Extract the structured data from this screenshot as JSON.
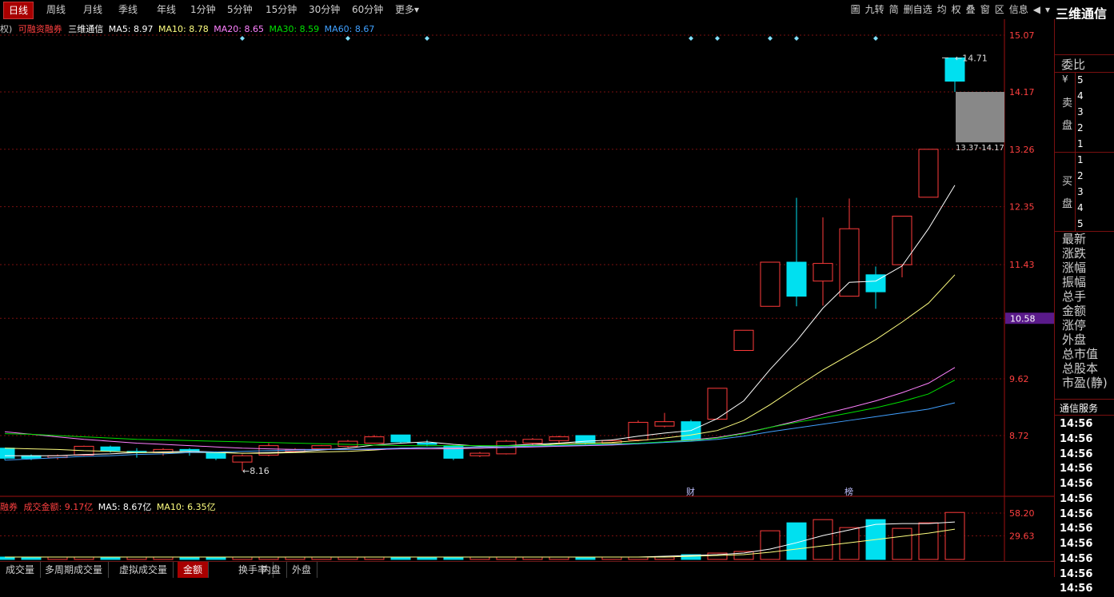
{
  "toolbar": {
    "tabs": [
      "日线",
      "周线",
      "月线",
      "季线",
      "年线",
      "1分钟",
      "5分钟",
      "15分钟",
      "30分钟",
      "60分钟",
      "更多▾"
    ],
    "tools": [
      "圖",
      "九转",
      "简",
      "删自选",
      "均",
      "权",
      "叠",
      "窗",
      "区",
      "信息"
    ],
    "arrow_left": "◀",
    "arrow_down": "▾"
  },
  "stock": {
    "name": "三维通信"
  },
  "main_info": {
    "prefix": "权)",
    "tag": "可融资融券",
    "name": "三维通信",
    "ma5": "MA5: 8.97",
    "ma10": "MA10: 8.78",
    "ma20": "MA20: 8.65",
    "ma30": "MA30: 8.59",
    "ma60": "MA60: 8.67"
  },
  "vol_info": {
    "prefix": "融券",
    "label": "成交金额: 9.17亿",
    "ma5": "MA5: 8.67亿",
    "ma10": "MA10: 6.35亿"
  },
  "colors": {
    "up": "#ff3b3b",
    "down": "#00e0f0",
    "ma5": "#ffffff",
    "ma10": "#ffff80",
    "ma20": "#ff80ff",
    "ma30": "#00e000",
    "ma60": "#40a0ff",
    "grid": "#7a1010",
    "axis_text": "#ff4040"
  },
  "chart_data": [
    {
      "type": "candlestick",
      "y_ticks": [
        15.07,
        14.17,
        13.26,
        12.35,
        11.43,
        10.58,
        9.62,
        8.72
      ],
      "current_price_label": "10.58",
      "annotations": [
        {
          "text": "14.71",
          "candle_index": 36,
          "price": 14.71
        },
        {
          "text": "8.16",
          "candle_index": 9,
          "price": 8.16
        },
        {
          "text": "13.37-14.17",
          "range": [
            13.37,
            14.17
          ]
        }
      ],
      "event_markers": [
        {
          "text": "财",
          "candle_index": 26
        },
        {
          "text": "榜",
          "candle_index": 32
        }
      ],
      "candles": [
        {
          "o": 8.52,
          "h": 8.52,
          "l": 8.33,
          "c": 8.36
        },
        {
          "o": 8.4,
          "h": 8.42,
          "l": 8.33,
          "c": 8.36
        },
        {
          "o": 8.37,
          "h": 8.42,
          "l": 8.34,
          "c": 8.4
        },
        {
          "o": 8.41,
          "h": 8.56,
          "l": 8.4,
          "c": 8.55
        },
        {
          "o": 8.54,
          "h": 8.56,
          "l": 8.45,
          "c": 8.48
        },
        {
          "o": 8.47,
          "h": 8.52,
          "l": 8.37,
          "c": 8.45
        },
        {
          "o": 8.45,
          "h": 8.52,
          "l": 8.4,
          "c": 8.5
        },
        {
          "o": 8.5,
          "h": 8.52,
          "l": 8.4,
          "c": 8.48
        },
        {
          "o": 8.46,
          "h": 8.47,
          "l": 8.33,
          "c": 8.36
        },
        {
          "o": 8.3,
          "h": 8.42,
          "l": 8.16,
          "c": 8.4
        },
        {
          "o": 8.41,
          "h": 8.6,
          "l": 8.39,
          "c": 8.56
        },
        {
          "o": 8.47,
          "h": 8.52,
          "l": 8.45,
          "c": 8.5
        },
        {
          "o": 8.51,
          "h": 8.57,
          "l": 8.49,
          "c": 8.56
        },
        {
          "o": 8.55,
          "h": 8.65,
          "l": 8.53,
          "c": 8.63
        },
        {
          "o": 8.6,
          "h": 8.73,
          "l": 8.59,
          "c": 8.7
        },
        {
          "o": 8.73,
          "h": 8.73,
          "l": 8.6,
          "c": 8.62
        },
        {
          "o": 8.6,
          "h": 8.65,
          "l": 8.55,
          "c": 8.58
        },
        {
          "o": 8.56,
          "h": 8.57,
          "l": 8.33,
          "c": 8.36
        },
        {
          "o": 8.4,
          "h": 8.46,
          "l": 8.38,
          "c": 8.44
        },
        {
          "o": 8.43,
          "h": 8.65,
          "l": 8.42,
          "c": 8.63
        },
        {
          "o": 8.6,
          "h": 8.68,
          "l": 8.55,
          "c": 8.66
        },
        {
          "o": 8.64,
          "h": 8.72,
          "l": 8.6,
          "c": 8.7
        },
        {
          "o": 8.72,
          "h": 8.72,
          "l": 8.58,
          "c": 8.6
        },
        {
          "o": 8.6,
          "h": 8.66,
          "l": 8.58,
          "c": 8.64
        },
        {
          "o": 8.65,
          "h": 8.96,
          "l": 8.63,
          "c": 8.93
        },
        {
          "o": 8.87,
          "h": 9.08,
          "l": 8.85,
          "c": 8.94
        },
        {
          "o": 8.94,
          "h": 8.97,
          "l": 8.63,
          "c": 8.65
        },
        {
          "o": 8.98,
          "h": 9.47,
          "l": 8.98,
          "c": 9.47
        },
        {
          "o": 10.07,
          "h": 10.39,
          "l": 10.07,
          "c": 10.39
        },
        {
          "o": 10.77,
          "h": 11.47,
          "l": 10.77,
          "c": 11.47
        },
        {
          "o": 11.47,
          "h": 12.49,
          "l": 10.77,
          "c": 10.93
        },
        {
          "o": 11.17,
          "h": 12.18,
          "l": 10.78,
          "c": 11.45
        },
        {
          "o": 10.93,
          "h": 12.48,
          "l": 10.93,
          "c": 12.0
        },
        {
          "o": 11.27,
          "h": 11.4,
          "l": 10.73,
          "c": 11.0
        },
        {
          "o": 11.43,
          "h": 11.43,
          "l": 11.23,
          "c": 12.2
        },
        {
          "o": 12.5,
          "h": 13.26,
          "l": 12.5,
          "c": 13.26
        },
        {
          "o": 14.71,
          "h": 14.71,
          "l": 14.17,
          "c": 14.34
        }
      ],
      "ma": {
        "ma5": [
          8.4,
          8.4,
          8.4,
          8.42,
          8.43,
          8.45,
          8.46,
          8.47,
          8.46,
          8.44,
          8.45,
          8.46,
          8.49,
          8.52,
          8.57,
          8.6,
          8.62,
          8.58,
          8.55,
          8.56,
          8.58,
          8.6,
          8.63,
          8.65,
          8.71,
          8.76,
          8.8,
          8.99,
          9.27,
          9.77,
          10.22,
          10.74,
          11.15,
          11.17,
          11.41,
          12.0,
          12.69
        ],
        "ma10": [
          8.52,
          8.51,
          8.5,
          8.48,
          8.47,
          8.45,
          8.45,
          8.45,
          8.45,
          8.44,
          8.44,
          8.45,
          8.46,
          8.47,
          8.49,
          8.52,
          8.53,
          8.52,
          8.52,
          8.54,
          8.56,
          8.59,
          8.6,
          8.61,
          8.64,
          8.68,
          8.73,
          8.8,
          8.96,
          9.21,
          9.49,
          9.76,
          10.0,
          10.24,
          10.52,
          10.82,
          11.27
        ],
        "ma20": [
          8.78,
          8.74,
          8.7,
          8.66,
          8.63,
          8.6,
          8.58,
          8.56,
          8.54,
          8.52,
          8.51,
          8.5,
          8.5,
          8.5,
          8.5,
          8.51,
          8.51,
          8.51,
          8.52,
          8.53,
          8.54,
          8.55,
          8.56,
          8.57,
          8.59,
          8.62,
          8.65,
          8.69,
          8.76,
          8.85,
          8.95,
          9.06,
          9.16,
          9.27,
          9.4,
          9.55,
          9.8
        ],
        "ma30": [
          8.75,
          8.74,
          8.72,
          8.7,
          8.68,
          8.66,
          8.65,
          8.64,
          8.63,
          8.62,
          8.61,
          8.6,
          8.59,
          8.58,
          8.57,
          8.56,
          8.56,
          8.56,
          8.56,
          8.56,
          8.56,
          8.57,
          8.58,
          8.59,
          8.6,
          8.62,
          8.64,
          8.68,
          8.75,
          8.85,
          8.93,
          9.0,
          9.08,
          9.16,
          9.26,
          9.38,
          9.6
        ],
        "ma60": [
          8.33,
          8.35,
          8.37,
          8.39,
          8.4,
          8.42,
          8.43,
          8.45,
          8.46,
          8.47,
          8.48,
          8.49,
          8.5,
          8.5,
          8.51,
          8.52,
          8.53,
          8.53,
          8.54,
          8.54,
          8.55,
          8.56,
          8.57,
          8.58,
          8.59,
          8.61,
          8.63,
          8.66,
          8.71,
          8.78,
          8.84,
          8.9,
          8.96,
          9.02,
          9.08,
          9.14,
          9.24
        ]
      }
    },
    {
      "type": "bar",
      "y_ticks": [
        58.2,
        29.63
      ],
      "volumes": [
        3,
        3,
        3,
        3,
        3,
        3,
        3,
        3,
        3,
        3,
        3,
        3,
        3,
        3,
        3,
        3,
        3,
        3,
        3,
        3,
        3,
        3,
        3,
        3,
        3,
        3,
        6,
        8,
        10,
        36,
        46,
        50,
        40,
        50,
        39,
        46,
        59,
        37
      ],
      "directions": [
        "d",
        "d",
        "u",
        "u",
        "d",
        "u",
        "u",
        "d",
        "d",
        "u",
        "u",
        "u",
        "u",
        "u",
        "u",
        "d",
        "d",
        "d",
        "u",
        "u",
        "u",
        "u",
        "d",
        "u",
        "u",
        "u",
        "d",
        "u",
        "u",
        "u",
        "d",
        "u",
        "u",
        "d",
        "u",
        "u",
        "u",
        "u"
      ],
      "ma5": [
        3,
        3,
        3,
        3,
        3,
        3,
        3,
        3,
        3,
        3,
        3,
        3,
        3,
        3,
        3,
        3,
        3,
        3,
        3,
        3,
        3,
        3,
        3,
        3,
        3,
        4,
        5,
        6,
        8,
        13,
        21,
        30,
        37,
        44,
        45,
        45,
        47,
        46
      ],
      "ma10": [
        3,
        3,
        3,
        3,
        3,
        3,
        3,
        3,
        3,
        3,
        3,
        3,
        3,
        3,
        3,
        3,
        3,
        3,
        3,
        3,
        3,
        3,
        3,
        3,
        3,
        3,
        4,
        5,
        6,
        9,
        13,
        17,
        21,
        25,
        29,
        33,
        38,
        43
      ]
    }
  ],
  "sidebar": {
    "weibi": "委比",
    "yen": "¥",
    "sell_labels": [
      "卖",
      "盘"
    ],
    "buy_labels": [
      "买",
      "盘"
    ],
    "sell_levels": [
      "5",
      "4",
      "3",
      "2",
      "1"
    ],
    "buy_levels": [
      "1",
      "2",
      "3",
      "4",
      "5"
    ],
    "fields": [
      "最新",
      "涨跌",
      "涨幅",
      "振幅",
      "总手",
      "金额",
      "涨停",
      "外盘",
      "总市值",
      "总股本",
      "市盈(静)"
    ],
    "trade_title": "通信服务",
    "times": [
      "14:56",
      "14:56",
      "14:56",
      "14:56",
      "14:56",
      "14:56",
      "14:56",
      "14:56",
      "14:56",
      "14:56",
      "14:56",
      "14:56"
    ]
  },
  "bottom_tabs": [
    "成交量",
    "多周期成交量",
    "虚拟成交量",
    "金额",
    "换手率",
    "内盘",
    "外盘"
  ],
  "bottom_active": 3,
  "top_active": 0
}
